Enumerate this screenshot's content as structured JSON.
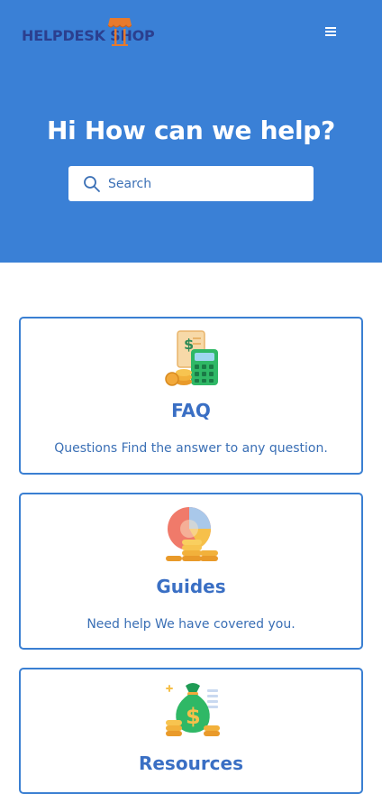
{
  "header": {
    "logo_text": "HELPDESK SHOP",
    "menu_icon": "hamburger-menu-icon"
  },
  "hero": {
    "title": "Hi How can we help?",
    "search": {
      "placeholder": "Search",
      "value": "",
      "icon": "search-icon"
    }
  },
  "cards": [
    {
      "title": "FAQ",
      "description": "Questions Find the answer to any question.",
      "icon": "calculator-coins-icon"
    },
    {
      "title": "Guides",
      "description": "Need help We have covered you.",
      "icon": "pie-chart-coins-icon"
    },
    {
      "title": "Resources",
      "description": "",
      "icon": "money-bag-icon"
    }
  ],
  "colors": {
    "hero_bg": "#3a80d6",
    "accent": "#3a7fd2",
    "logo_text": "#2b3f8f",
    "logo_mark": "#e87a2c"
  }
}
